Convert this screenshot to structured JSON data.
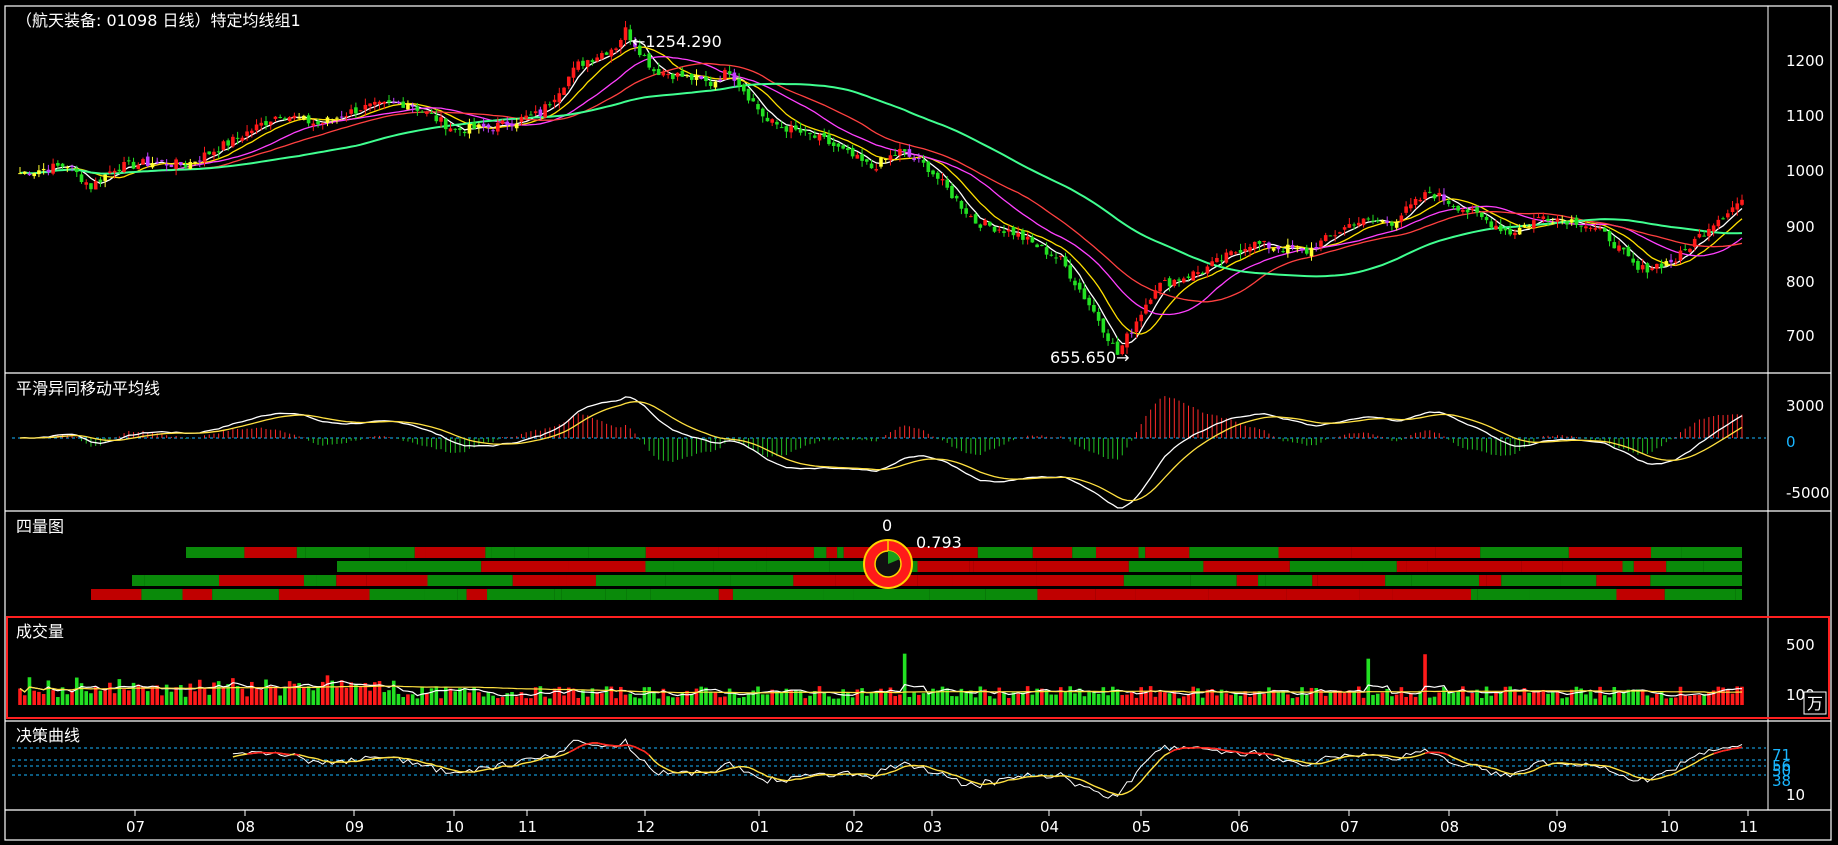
{
  "main_panel": {
    "title": "（航天装备: 01098 日线）特定均线组1",
    "high_label": "←1254.290",
    "low_label": "655.650→",
    "y_ticks": [
      "1200",
      "1100",
      "1000",
      "900",
      "800",
      "700"
    ]
  },
  "macd_panel": {
    "title": "平滑异同移动平均线",
    "y_ticks": [
      "3000",
      "0",
      "-5000"
    ]
  },
  "quadrant_panel": {
    "title": "四量图",
    "top_value": "0",
    "ratio_value": "0.793"
  },
  "volume_panel": {
    "title": "成交量",
    "y_ticks": [
      "500",
      "100"
    ],
    "unit": "万"
  },
  "decision_panel": {
    "title": "决策曲线",
    "y_ticks": [
      "71",
      "56",
      "50",
      "38",
      "10"
    ]
  },
  "x_axis": {
    "months": [
      "07",
      "08",
      "09",
      "10",
      "11",
      "12",
      "01",
      "02",
      "03",
      "04",
      "05",
      "06",
      "07",
      "08",
      "09",
      "10",
      "11"
    ]
  },
  "colors": {
    "up": "#ff1a1a",
    "down": "#22e022",
    "axis_cyan": "#19b6ff",
    "border": "#ffffff",
    "selected_panel_border": "#ff2020"
  },
  "chart_data": {
    "type": "line",
    "title": "（航天装备: 01098 日线）特定均线组1",
    "high": 1254.29,
    "low": 655.65,
    "ylim": [
      640,
      1270
    ],
    "anchors": [
      [
        0,
        990
      ],
      [
        10,
        1005
      ],
      [
        15,
        965
      ],
      [
        20,
        1000
      ],
      [
        28,
        1010
      ],
      [
        35,
        1005
      ],
      [
        45,
        1050
      ],
      [
        55,
        1100
      ],
      [
        63,
        1080
      ],
      [
        72,
        1110
      ],
      [
        82,
        1120
      ],
      [
        92,
        1070
      ],
      [
        100,
        1075
      ],
      [
        110,
        1100
      ],
      [
        118,
        1190
      ],
      [
        126,
        1225
      ],
      [
        128,
        1254
      ],
      [
        134,
        1180
      ],
      [
        142,
        1165
      ],
      [
        146,
        1155
      ],
      [
        150,
        1180
      ],
      [
        158,
        1085
      ],
      [
        170,
        1050
      ],
      [
        180,
        1000
      ],
      [
        186,
        1030
      ],
      [
        192,
        1000
      ],
      [
        202,
        900
      ],
      [
        210,
        880
      ],
      [
        220,
        830
      ],
      [
        228,
        720
      ],
      [
        232,
        655
      ],
      [
        240,
        780
      ],
      [
        250,
        810
      ],
      [
        260,
        860
      ],
      [
        272,
        845
      ],
      [
        282,
        900
      ],
      [
        290,
        900
      ],
      [
        298,
        955
      ],
      [
        306,
        920
      ],
      [
        315,
        880
      ],
      [
        322,
        910
      ],
      [
        330,
        900
      ],
      [
        336,
        870
      ],
      [
        342,
        810
      ],
      [
        350,
        830
      ],
      [
        358,
        900
      ],
      [
        364,
        940
      ]
    ]
  }
}
